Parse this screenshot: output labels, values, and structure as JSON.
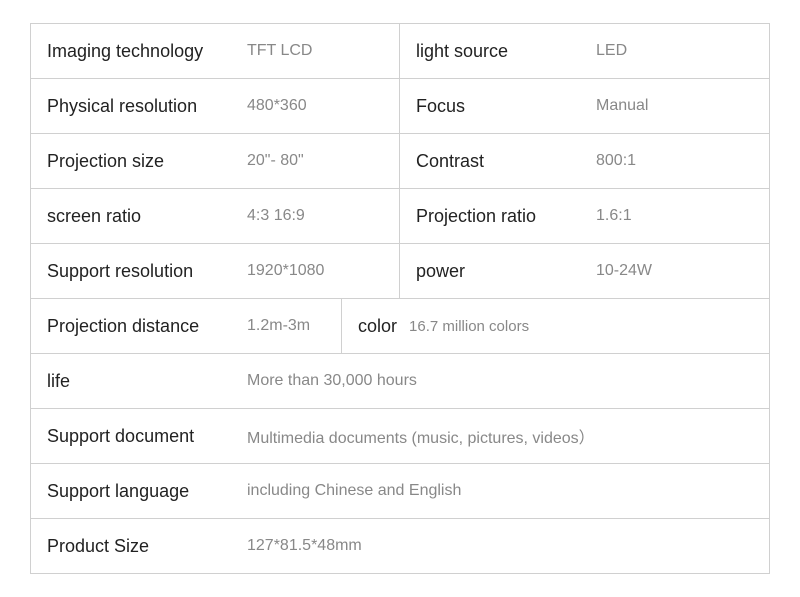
{
  "rows": [
    {
      "type": "split",
      "left_label": "Imaging technology",
      "left_value": "TFT LCD",
      "right_label": "light source",
      "right_value": "LED"
    },
    {
      "type": "split",
      "left_label": "Physical resolution",
      "left_value": "480*360",
      "right_label": "Focus",
      "right_value": "Manual"
    },
    {
      "type": "split",
      "left_label": "Projection size",
      "left_value": "20\"- 80\"",
      "right_label": "Contrast",
      "right_value": "800:1"
    },
    {
      "type": "split",
      "left_label": "screen ratio",
      "left_value": "4:3  16:9",
      "right_label": "Projection ratio",
      "right_value": "1.6:1"
    },
    {
      "type": "split",
      "left_label": "Support resolution",
      "left_value": "1920*1080",
      "right_label": "power",
      "right_value": "10-24W"
    },
    {
      "type": "split_inline_right",
      "left_label": "Projection distance",
      "left_value": "1.2m-3m",
      "right_label_inline": "color",
      "right_value_inline": "16.7 million colors"
    },
    {
      "type": "full",
      "label": "life",
      "value": "More than 30,000 hours"
    },
    {
      "type": "full",
      "label": "Support document",
      "value": "Multimedia documents (music, pictures, videos）"
    },
    {
      "type": "full",
      "label": "Support language",
      "value": "including Chinese and English"
    },
    {
      "type": "full",
      "label": "Product Size",
      "value": "127*81.5*48mm"
    }
  ]
}
